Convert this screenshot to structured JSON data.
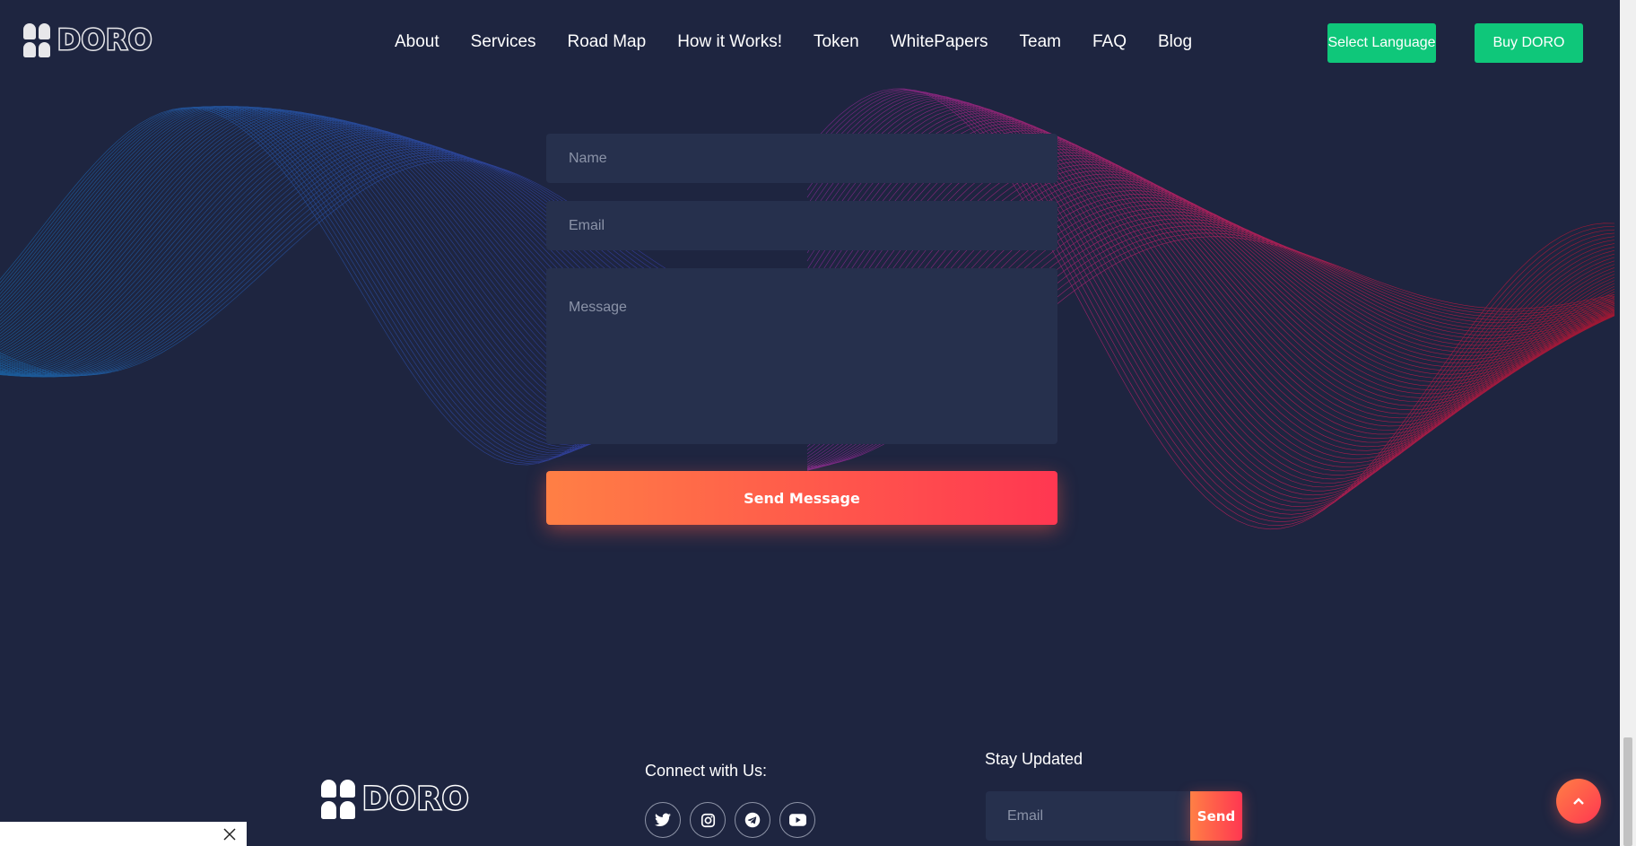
{
  "brand": {
    "name": "DORO"
  },
  "nav": {
    "items": [
      {
        "label": "About"
      },
      {
        "label": "Services"
      },
      {
        "label": "Road Map"
      },
      {
        "label": "How it Works!"
      },
      {
        "label": "Token"
      },
      {
        "label": "WhitePapers"
      },
      {
        "label": "Team"
      },
      {
        "label": "FAQ"
      },
      {
        "label": "Blog"
      }
    ],
    "select_language_label": "Select Language",
    "buy_label": "Buy DORO"
  },
  "contact_form": {
    "name_placeholder": "Name",
    "email_placeholder": "Email",
    "message_placeholder": "Message",
    "submit_label": "Send Message"
  },
  "footer": {
    "connect_title": "Connect with Us:",
    "socials": [
      "twitter-icon",
      "instagram-icon",
      "telegram-icon",
      "youtube-icon"
    ],
    "stay_updated_title": "Stay Updated",
    "newsletter_placeholder": "Email",
    "newsletter_button": "Send"
  },
  "colors": {
    "background": "#1e2540",
    "field": "#26304d",
    "accent_green": "#0fc77a",
    "gradient_start": "#ff7f45",
    "gradient_end": "#ff3751"
  }
}
